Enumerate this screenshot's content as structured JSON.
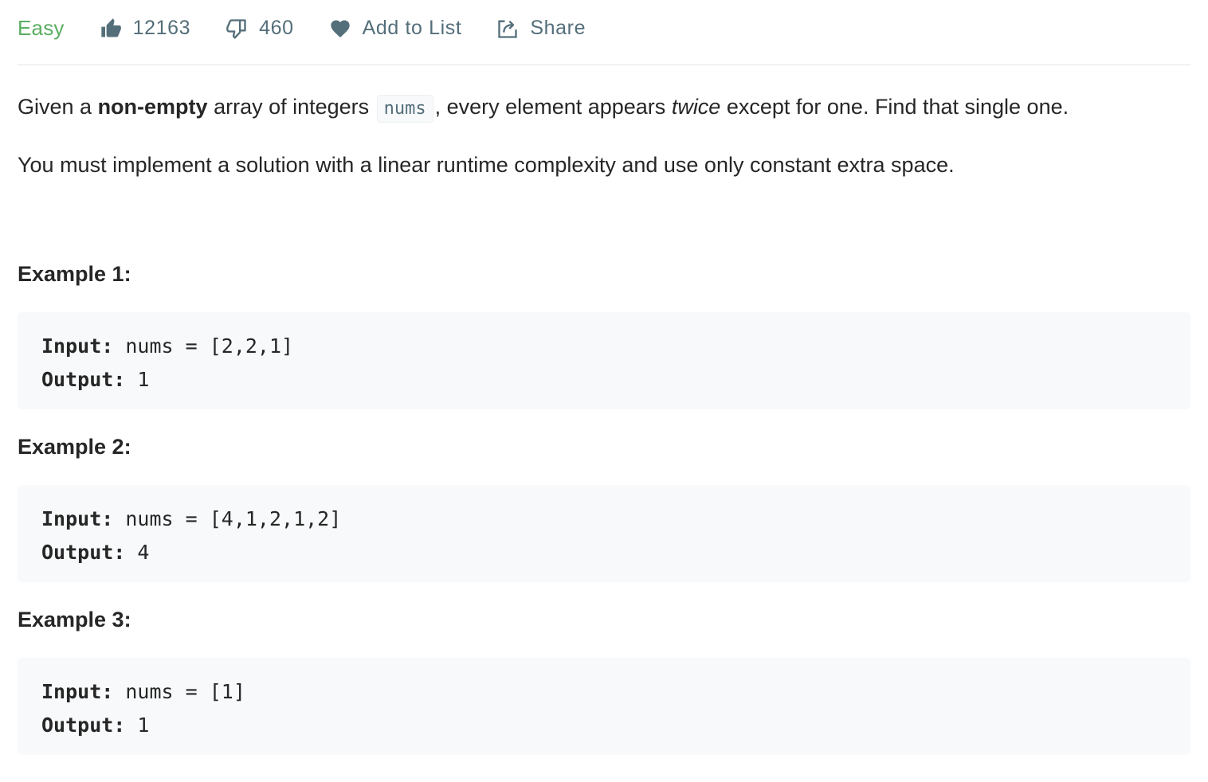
{
  "header": {
    "difficulty": "Easy",
    "likes": "12163",
    "dislikes": "460",
    "add_to_list_label": "Add to List",
    "share_label": "Share",
    "icons": [
      "thumbs-up-icon",
      "thumbs-down-icon",
      "heart-icon",
      "share-icon"
    ],
    "colors": {
      "difficulty": "#5cae62",
      "action": "#546e7a"
    }
  },
  "description": {
    "p1": {
      "t1": "Given a ",
      "bold": "non-empty",
      "t2": " array of integers ",
      "code": "nums",
      "t3": ", every element appears ",
      "italic": "twice",
      "t4": " except for one. Find that single one."
    },
    "p2": "You must implement a solution with a linear runtime complexity and use only constant extra space."
  },
  "examples": [
    {
      "title": "Example 1:",
      "input_label": "Input:",
      "input_value": " nums = [2,2,1]",
      "output_label": "Output:",
      "output_value": " 1"
    },
    {
      "title": "Example 2:",
      "input_label": "Input:",
      "input_value": " nums = [4,1,2,1,2]",
      "output_label": "Output:",
      "output_value": " 4"
    },
    {
      "title": "Example 3:",
      "input_label": "Input:",
      "input_value": " nums = [1]",
      "output_label": "Output:",
      "output_value": " 1"
    }
  ]
}
